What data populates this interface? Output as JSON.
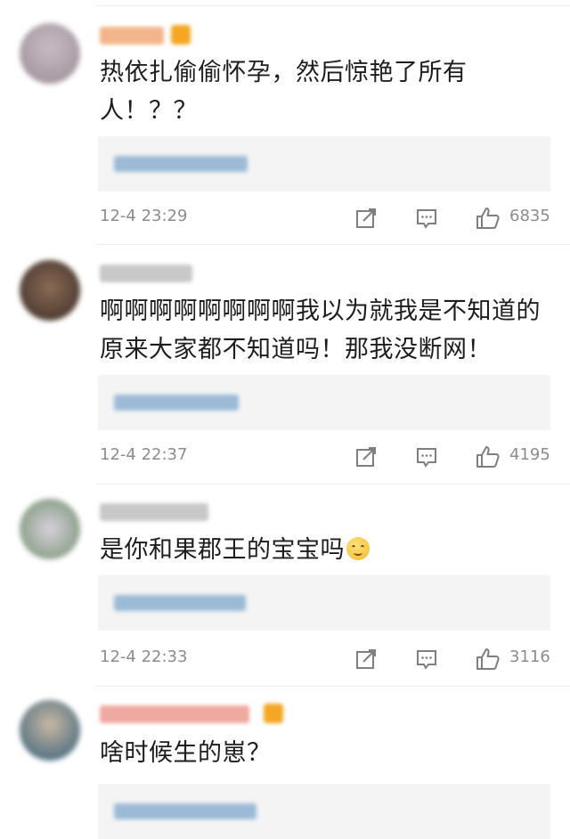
{
  "comments": [
    {
      "text": "热依扎偷偷怀孕，然后惊艳了所有人！？？",
      "time": "12-4 23:29",
      "likes": "6835",
      "avatar_colors": [
        "#9b8a94",
        "#c7bcc3"
      ],
      "username_color": "#f2b58a",
      "has_vip": true,
      "vip_color": "#f5a623",
      "reply_preview_color": "#9bbad6"
    },
    {
      "text": "啊啊啊啊啊啊啊啊我以为就我是不知道的 原来大家都不知道吗！那我没断网！",
      "time": "12-4 22:37",
      "likes": "4195",
      "avatar_colors": [
        "#3a2b25",
        "#8a6a55"
      ],
      "username_color": "#c8c8c8",
      "has_vip": false,
      "vip_color": "",
      "reply_preview_color": "#9bbad6"
    },
    {
      "text": "是你和果郡王的宝宝吗",
      "has_emoji": true,
      "time": "12-4 22:33",
      "likes": "3116",
      "avatar_colors": [
        "#6f8f6a",
        "#d8d0dc"
      ],
      "username_color": "#c8c8c8",
      "has_vip": false,
      "vip_color": "",
      "reply_preview_color": "#9bbad6"
    },
    {
      "text": "啥时候生的崽？",
      "time": "",
      "likes": "",
      "avatar_colors": [
        "#2f5d7a",
        "#c9b7a3"
      ],
      "username_color": "#f0a9a0",
      "has_vip": true,
      "vip_color": "#f5a623",
      "reply_preview_color": "#9bbad6"
    }
  ],
  "icons": {
    "repost": "repost-icon",
    "comment": "comment-icon",
    "like": "like-icon"
  }
}
